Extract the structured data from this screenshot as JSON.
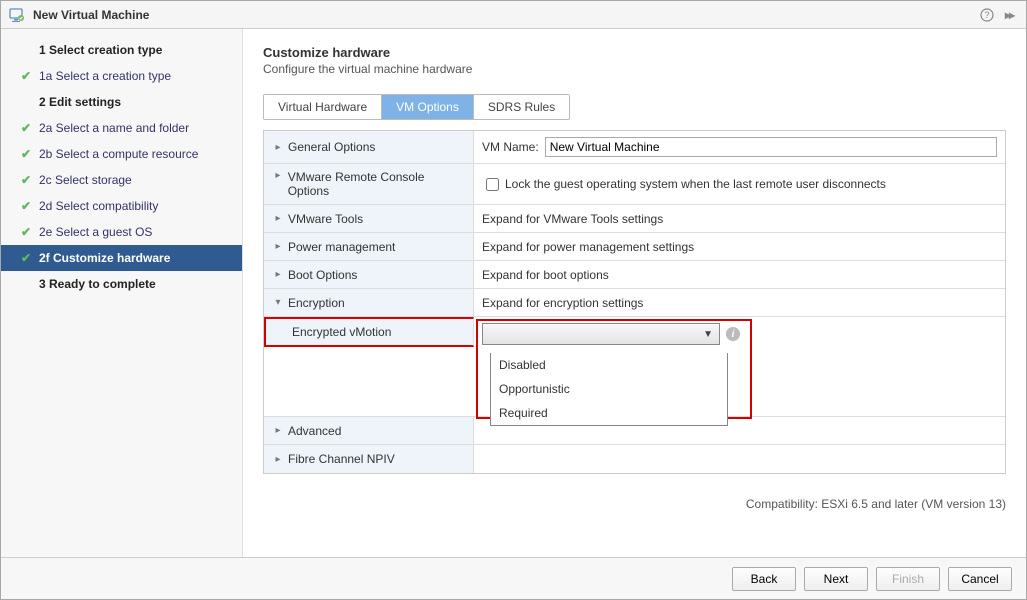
{
  "window": {
    "title": "New Virtual Machine"
  },
  "sidebar": {
    "items": [
      {
        "label": "1  Select creation type"
      },
      {
        "label": "1a  Select a creation type"
      },
      {
        "label": "2  Edit settings"
      },
      {
        "label": "2a  Select a name and folder"
      },
      {
        "label": "2b  Select a compute resource"
      },
      {
        "label": "2c  Select storage"
      },
      {
        "label": "2d  Select compatibility"
      },
      {
        "label": "2e  Select a guest OS"
      },
      {
        "label": "2f  Customize hardware"
      },
      {
        "label": "3  Ready to complete"
      }
    ]
  },
  "main": {
    "heading": "Customize hardware",
    "subtitle": "Configure the virtual machine hardware",
    "tabs": [
      {
        "label": "Virtual Hardware"
      },
      {
        "label": "VM Options"
      },
      {
        "label": "SDRS Rules"
      }
    ],
    "rows": {
      "general": {
        "label": "General Options",
        "vm_name_label": "VM Name:",
        "vm_name_value": "New Virtual Machine"
      },
      "remote_console": {
        "label": "VMware Remote Console Options",
        "checkbox_label": "Lock the guest operating system when the last remote user disconnects"
      },
      "vmware_tools": {
        "label": "VMware Tools",
        "hint": "Expand for VMware Tools settings"
      },
      "power": {
        "label": "Power management",
        "hint": "Expand for power management settings"
      },
      "boot": {
        "label": "Boot Options",
        "hint": "Expand for boot options"
      },
      "encryption": {
        "label": "Encryption",
        "hint": "Expand for encryption settings",
        "sub_label": "Encrypted vMotion",
        "options": [
          "Disabled",
          "Opportunistic",
          "Required"
        ]
      },
      "advanced": {
        "label": "Advanced"
      },
      "fcnpiv": {
        "label": "Fibre Channel NPIV"
      }
    },
    "compatibility": "Compatibility: ESXi 6.5 and later (VM version 13)"
  },
  "footer": {
    "back": "Back",
    "next": "Next",
    "finish": "Finish",
    "cancel": "Cancel"
  }
}
